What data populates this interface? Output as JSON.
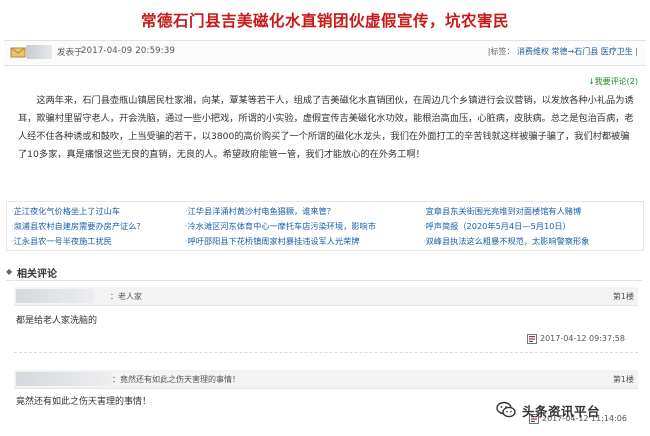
{
  "page_title": "常德石门县吉美磁化水直销团伙虚假宣传，坑农害民",
  "post": {
    "time_label": "发表于",
    "time": "2017-04-09 20:59:39",
    "tags_label": "|标签：",
    "tags_links": "消费维权  常德→石门县  医疗卫生",
    "tags_end": "|",
    "reply_link": "我要评论",
    "reply_prefix": "↓",
    "reply_count_open": "(",
    "reply_count": "2",
    "reply_count_close": ")"
  },
  "content": "这两年来，石门县壶瓶山镇居民杜家湘，向某，覃某等若干人，组成了吉美磁化水直销团伙，在周边几个乡镇进行会议营销，以发放各种小礼品为诱耳，欺骗村里留守老人，开会洗脑，通过一些小把戏，所谓的小实验，虚假宣传吉美磁化水功效，能根治高血压，心脏病，皮肤病。总之是包治百病，老人经不住各种诱或和鼓吹，上当受骗的若干，以3800的高价购买了一个所谓的磁化水龙头，我们在外面打工的辛苦钱就这样被骗子骗了，我们村都被骗了10多家，真是痛恨这些无良的直销，无良的人。希望政府能管一管，我们才能放心的在外务工啊！",
  "related_links": [
    [
      "芷江夜化气价格坐上了过山车",
      "江华县洋涌村黄沙村电鱼猖獗，谁来管？",
      "宜章县东关街围光亮堆到对面楼馆有人赌博"
    ],
    [
      "溆浦县农村自建房需要办房产证么？",
      "冷水滩区河东体育中心一摩托车店污染环境，影响市",
      "呼声简报（2020年5月4日—5月10日）"
    ],
    [
      "江永县农一号半夜施工扰民",
      "呼吁邵阳县下花桥镇周家村暴挂违设军人光荣牌",
      "双峰县执法这么粗暴不规范，太影响警察形象"
    ]
  ],
  "related_bullet": "·",
  "comments_section": {
    "bullet": "◆",
    "label": "相关评论"
  },
  "comments": [
    {
      "user": "：老人家",
      "floor": "第1楼",
      "text": "都是给老人家洗脑的",
      "time": "2017-04-12 09:37:58"
    },
    {
      "user": "：竟然还有如此之伤天害理的事情！",
      "floor": "第1楼",
      "text": "竟然还有如此之伤天害理的事情！",
      "time": "2017-04-12 11:14:06"
    }
  ],
  "watermark": "头条资讯平台",
  "colors": {
    "title": "#c81818",
    "link": "#1a5fa8",
    "reply": "#1a8a2e"
  }
}
